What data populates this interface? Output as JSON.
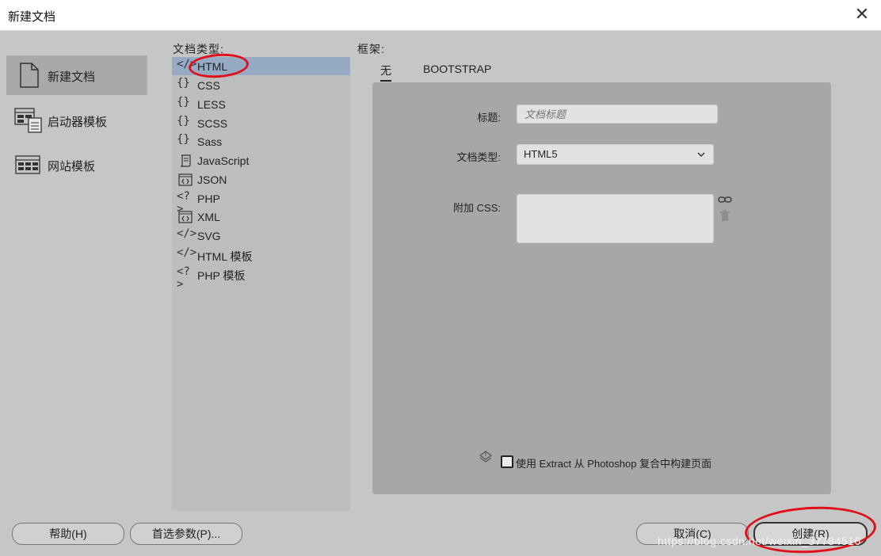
{
  "window": {
    "title": "新建文档",
    "close_icon": "close-icon"
  },
  "categories": [
    {
      "label": "新建文档",
      "icon": "document-icon",
      "active": true
    },
    {
      "label": "启动器模板",
      "icon": "starter-template-icon",
      "active": false
    },
    {
      "label": "网站模板",
      "icon": "site-template-icon",
      "active": false
    }
  ],
  "doc_types": {
    "label": "文档类型:",
    "items": [
      {
        "icon": "</>",
        "label": "HTML",
        "selected": true
      },
      {
        "icon": "{}",
        "label": "CSS"
      },
      {
        "icon": "{}",
        "label": "LESS"
      },
      {
        "icon": "{}",
        "label": "SCSS"
      },
      {
        "icon": "{}",
        "label": "Sass"
      },
      {
        "icon": "js-file-icon",
        "label": "JavaScript"
      },
      {
        "icon": "<>",
        "label": "JSON"
      },
      {
        "icon": "<?>",
        "label": "PHP"
      },
      {
        "icon": "<>",
        "label": "XML"
      },
      {
        "icon": "</>",
        "label": "SVG"
      },
      {
        "icon": "</>",
        "label": "HTML 模板"
      },
      {
        "icon": "<?>",
        "label": "PHP 模板"
      }
    ]
  },
  "framework": {
    "label": "框架:",
    "tabs": [
      {
        "label": "无",
        "active": true
      },
      {
        "label": "BOOTSTRAP",
        "active": false
      }
    ]
  },
  "form": {
    "title_label": "标题:",
    "title_placeholder": "文档标题",
    "doctype_label": "文档类型:",
    "doctype_value": "HTML5",
    "css_label": "附加 CSS:",
    "extract_text": "使用 Extract 从 Photoshop 复合中构建页面"
  },
  "buttons": {
    "help": "帮助(H)",
    "prefs": "首选参数(P)...",
    "cancel": "取消(C)",
    "create": "创建(R)"
  },
  "watermark": "https://blog.csdn.net/weixin_37784516",
  "colors": {
    "selection": "#97aac4",
    "annotation": "#e0101a"
  }
}
